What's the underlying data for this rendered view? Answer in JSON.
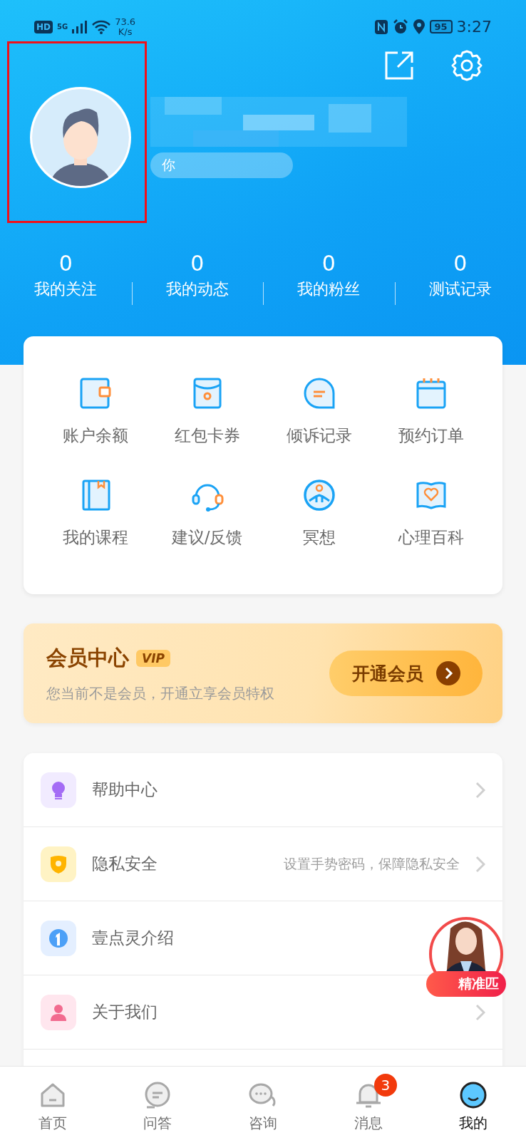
{
  "status_bar": {
    "network_badge": "HD",
    "network_type": "5G",
    "speed": [
      "73.6",
      "K/s"
    ],
    "battery": "95",
    "time": "3:27"
  },
  "profile": {
    "signature": "你"
  },
  "stats": [
    {
      "value": "0",
      "label": "我的关注"
    },
    {
      "value": "0",
      "label": "我的动态"
    },
    {
      "value": "0",
      "label": "我的粉丝"
    },
    {
      "value": "0",
      "label": "测试记录"
    }
  ],
  "services": [
    {
      "kind": "wallet",
      "label": "账户余额"
    },
    {
      "kind": "envelope",
      "label": "红包卡券"
    },
    {
      "kind": "chat",
      "label": "倾诉记录"
    },
    {
      "kind": "calendar",
      "label": "预约订单"
    },
    {
      "kind": "book",
      "label": "我的课程"
    },
    {
      "kind": "headset",
      "label": "建议/反馈"
    },
    {
      "kind": "meditation",
      "label": "冥想"
    },
    {
      "kind": "heartbook",
      "label": "心理百科"
    }
  ],
  "vip": {
    "title": "会员中心",
    "tag": "VIP",
    "subtitle": "您当前不是会员，开通立享会员特权",
    "button": "开通会员"
  },
  "menu": [
    {
      "kind": "bulb",
      "label": "帮助中心",
      "chevron": true
    },
    {
      "kind": "shield",
      "label": "隐私安全",
      "hint": "设置手势密码，保障隐私安全",
      "chevron": true
    },
    {
      "kind": "one",
      "label": "壹点灵介绍",
      "chevron": false
    },
    {
      "kind": "person",
      "label": "关于我们",
      "chevron": true
    }
  ],
  "floating_badge": {
    "label": "精准匹"
  },
  "tab_bar": [
    {
      "kind": "home",
      "label": "首页",
      "selected": false
    },
    {
      "kind": "answer",
      "label": "问答",
      "selected": false
    },
    {
      "kind": "consult",
      "label": "咨询",
      "selected": false
    },
    {
      "kind": "bell",
      "label": "消息",
      "selected": false,
      "badge": "3"
    },
    {
      "kind": "me",
      "label": "我的",
      "selected": true
    }
  ]
}
